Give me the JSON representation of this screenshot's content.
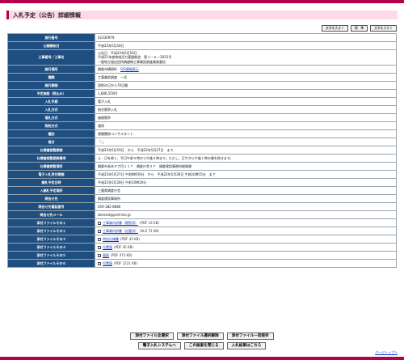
{
  "page": {
    "title": "入札予定（公告）詳細情報",
    "size_buttons": [
      "文字を大きく",
      "標　準",
      "文字を小さく"
    ],
    "page_top": "ページトップへ"
  },
  "rows": [
    {
      "label": "施行番号",
      "value": "42330979"
    },
    {
      "label": "公開開始日",
      "value": "平成22年5月18日"
    },
    {
      "label": "工事番号／工事名",
      "lines": [
        "公告日　平成22年5月19日",
        "平成21年度地域活力基盤創造　第１－６－2015号",
        "一般地方道自田所鍋越線工事業設調査業務委託"
      ]
    },
    {
      "label": "施行場所",
      "value": "鍋倉市鍋岡町",
      "link": "GIS情報表示"
    },
    {
      "label": "種類",
      "value": "工事業前調査　一式"
    },
    {
      "label": "施行期間",
      "value": "契約の日から70日間"
    },
    {
      "label": "予定価格（税込み）",
      "value": "1,686,550円"
    },
    {
      "label": "入札手続",
      "value": "電子入札"
    },
    {
      "label": "入札方式",
      "value": "指名競争入札"
    },
    {
      "label": "落札方式",
      "value": "価格競争"
    },
    {
      "label": "契約方式",
      "value": "通常"
    },
    {
      "label": "種別",
      "value": "建築関係コンサルタント"
    },
    {
      "label": "格付",
      "value": "「-」"
    },
    {
      "label": "仕様書閲覧期間",
      "value": "平成22年5月19日　から　平成22年5月27日　まで"
    },
    {
      "label": "仕様書閲覧期間備考",
      "value": "土・日を除く、平日午前９時から午後４時まで。ただし、正午から午後１時の間を除きます。"
    },
    {
      "label": "仕様書閲覧場所",
      "value": "鍋倉市長本５丁目１１７　鍋倉庁舎３Ｆ　鍋倉建設事務所総務課"
    },
    {
      "label": "電子入札受付期間",
      "value": "平成22年5月27日 午前8時30分　から　平成22年5月28日 午前10時15分　まで"
    },
    {
      "label": "開札予定日時",
      "value": "平成22年5月28日 午前10時20分"
    },
    {
      "label": "入開札予定場所",
      "value": "三重県鍋倉庁舎"
    },
    {
      "label": "問合せ先",
      "value": "鍋倉建設事務所"
    },
    {
      "label": "問合せ先電話番号",
      "value": "059-382-8680"
    },
    {
      "label": "問合せ先メール",
      "value": "zkenset@pref.mie.jp"
    },
    {
      "label": "添付ファイルその１",
      "file": "工事業内訳書（閲覧用）",
      "size": "(PDF 33 KB)"
    },
    {
      "label": "添付ファイルその２",
      "file": "工事業内訳書（記載用）",
      "size": "(XLS 72 KB)"
    },
    {
      "label": "添付ファイルその３",
      "file": "特記仕様書",
      "size": "(PDF 43 KB)"
    },
    {
      "label": "添付ファイルその４",
      "file": "位置図",
      "size": "(PDF 45 KB)"
    },
    {
      "label": "添付ファイルその５",
      "file": "図面",
      "size": "(PDF 473 KB)"
    },
    {
      "label": "添付ファイルその６",
      "file": "位置図",
      "size": "(PDF 1221 KB)"
    }
  ],
  "buttons_row1": [
    "添付ファイル全選択",
    "添付ファイル選択解除",
    "添付ファイル一括保存"
  ],
  "buttons_row2": [
    "電子入札システムへ",
    "この画面を閉じる",
    "入札結果はこちら"
  ]
}
